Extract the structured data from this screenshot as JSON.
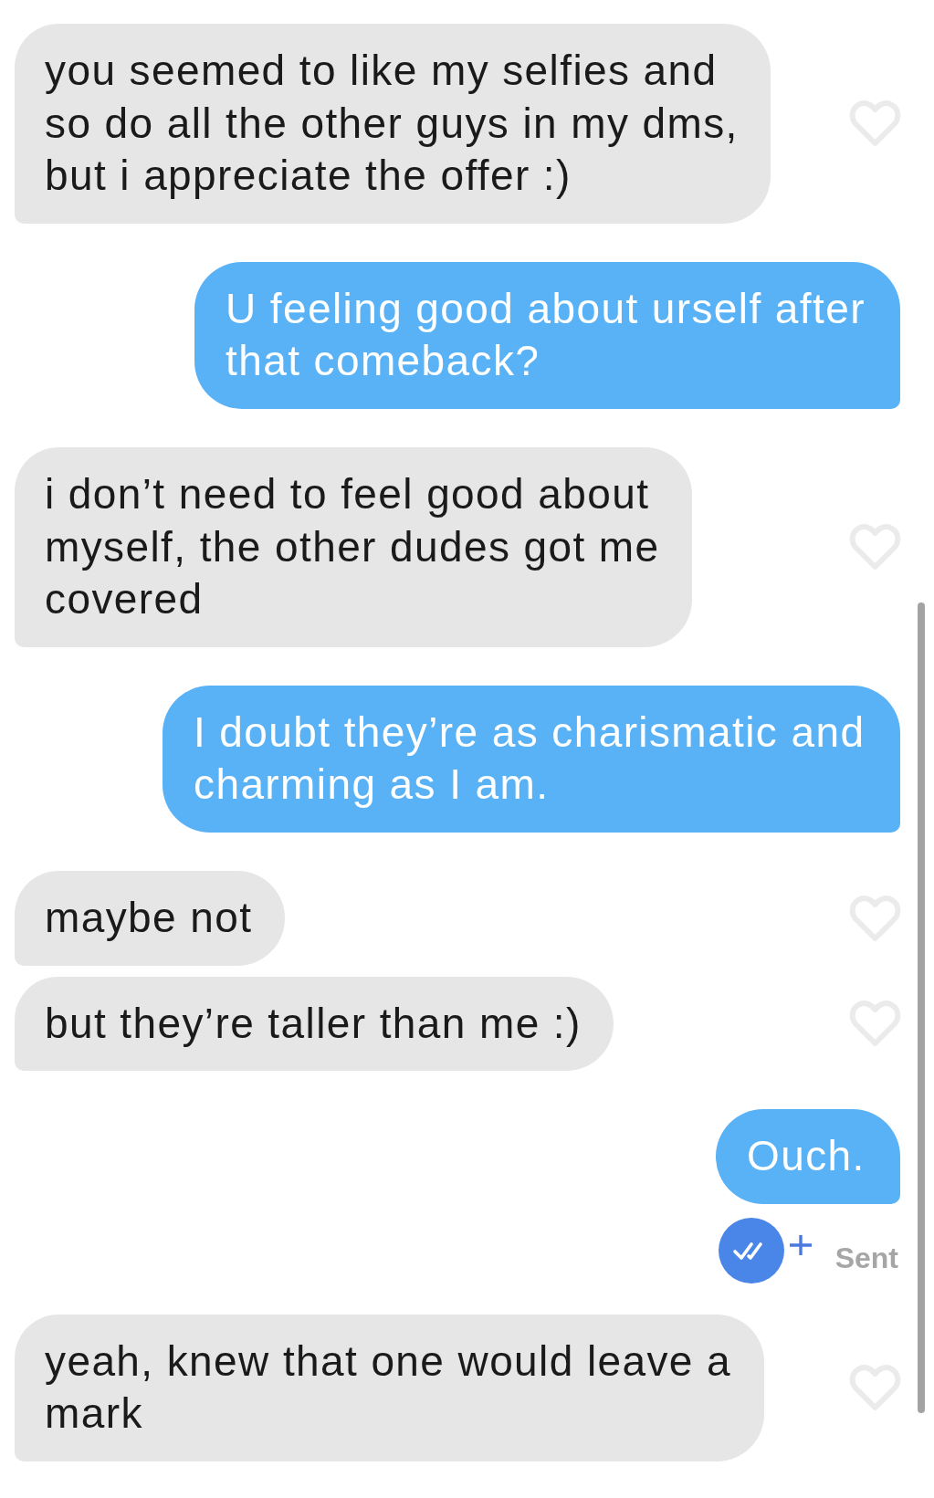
{
  "messages": [
    {
      "kind": "received",
      "text": "you seemed to like my selfies and so do all the other guys in my dms, but i appreciate the offer :)",
      "liked": false
    },
    {
      "kind": "sent",
      "text": "U feeling good about urself after that comeback?"
    },
    {
      "kind": "received",
      "text": "i don’t need to feel good about myself, the other dudes got me covered",
      "liked": false
    },
    {
      "kind": "sent",
      "text": "I doubt they’re as charismatic and charming as I am."
    },
    {
      "kind": "received",
      "text": "maybe not",
      "liked": false
    },
    {
      "kind": "received",
      "text": "but they’re taller than me :)",
      "liked": false
    },
    {
      "kind": "sent",
      "text": "Ouch.",
      "status": "Sent"
    },
    {
      "kind": "received",
      "text": "yeah, knew that one would leave a mark",
      "liked": false
    }
  ]
}
